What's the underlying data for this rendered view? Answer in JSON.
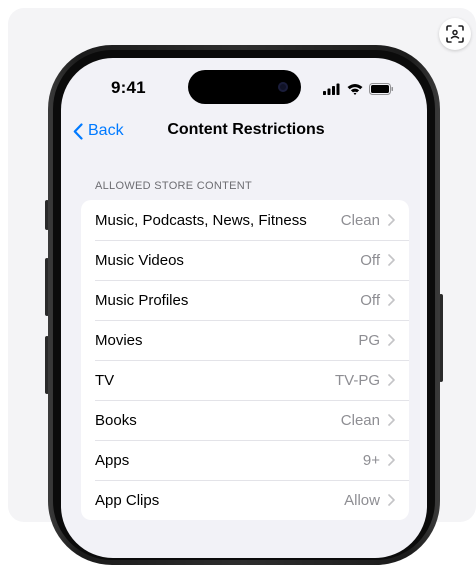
{
  "status_bar": {
    "time": "9:41"
  },
  "nav": {
    "back_label": "Back",
    "title": "Content Restrictions"
  },
  "section": {
    "header": "ALLOWED STORE CONTENT",
    "items": [
      {
        "label": "Music, Podcasts, News, Fitness",
        "value": "Clean"
      },
      {
        "label": "Music Videos",
        "value": "Off"
      },
      {
        "label": "Music Profiles",
        "value": "Off"
      },
      {
        "label": "Movies",
        "value": "PG"
      },
      {
        "label": "TV",
        "value": "TV-PG"
      },
      {
        "label": "Books",
        "value": "Clean"
      },
      {
        "label": "Apps",
        "value": "9+"
      },
      {
        "label": "App Clips",
        "value": "Allow"
      }
    ]
  },
  "icons": {
    "back": "chevron-left-icon",
    "disclosure": "chevron-right-icon",
    "lens": "visual-lookup-icon",
    "signal": "cellular-signal-icon",
    "wifi": "wifi-icon",
    "battery": "battery-icon"
  },
  "colors": {
    "accent": "#007aff",
    "secondary_text": "#8e8e93",
    "grouped_background": "#f2f2f7"
  }
}
